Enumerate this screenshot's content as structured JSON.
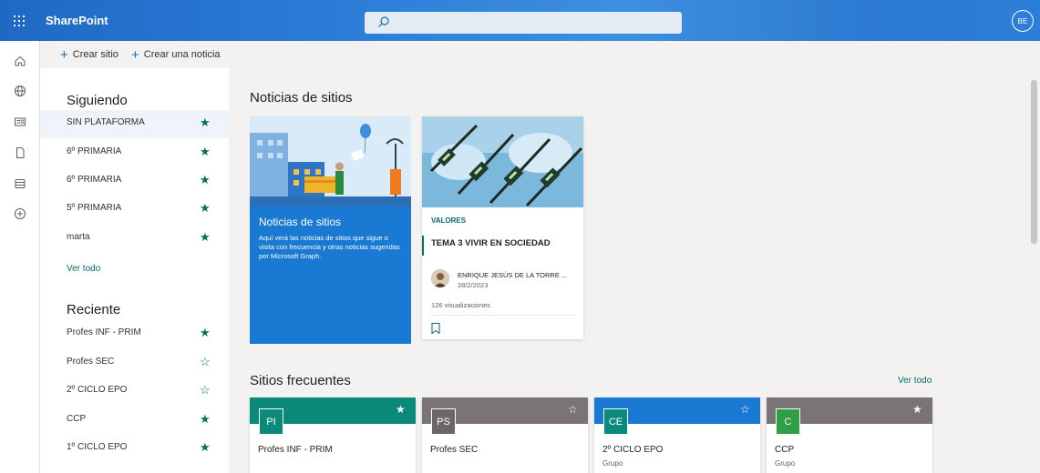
{
  "app": {
    "title": "SharePoint",
    "user_initials": "BE"
  },
  "colors": {
    "accent": "#0b6a62",
    "suite_bar": "#2a7bd6",
    "news_blue": "#1a7ad3"
  },
  "rail": {
    "icons": [
      "home-icon",
      "globe-icon",
      "news-icon",
      "file-icon",
      "list-icon",
      "add-circle-icon"
    ]
  },
  "commands": {
    "create_site": "Crear sitio",
    "create_news": "Crear una noticia"
  },
  "sidebar": {
    "following_title": "Siguiendo",
    "following": [
      {
        "name": "SIN PLATAFORMA",
        "starred": true
      },
      {
        "name": "6º PRIMARIA",
        "starred": true
      },
      {
        "name": "6º PRIMARIA",
        "starred": true
      },
      {
        "name": "5º PRIMARIA",
        "starred": true
      },
      {
        "name": "marta",
        "starred": true
      }
    ],
    "see_all": "Ver todo",
    "recent_title": "Reciente",
    "recent": [
      {
        "name": "Profes INF - PRIM",
        "starred": true
      },
      {
        "name": "Profes SEC",
        "starred": false
      },
      {
        "name": "2º CICLO EPO",
        "starred": false
      },
      {
        "name": "CCP",
        "starred": true
      },
      {
        "name": "1º CICLO EPO",
        "starred": true
      }
    ]
  },
  "news": {
    "title": "Noticias de sitios",
    "promo": {
      "title": "Noticias de sitios",
      "description": "Aquí verá las noticias de sitios que sigue o visita con frecuencia y otras noticias sugeridas por Microsoft Graph."
    },
    "article": {
      "category": "VALORES",
      "title": "TEMA 3 VIVIR EN SOCIEDAD",
      "author": "ENRIQUE JESÚS DE LA TORRE ...",
      "date": "28/2/2023",
      "views": "126 visualizaciones"
    }
  },
  "frequent": {
    "title": "Sitios frecuentes",
    "see_all": "Ver todo",
    "sites": [
      {
        "initials": "PI",
        "name": "Profes INF - PRIM",
        "type": "",
        "band_color": "#0b8a7a",
        "tile_color": "#0b8a7a",
        "starred": true
      },
      {
        "initials": "PS",
        "name": "Profes SEC",
        "type": "",
        "band_color": "#7a7574",
        "tile_color": "#6b6766",
        "starred": false
      },
      {
        "initials": "CE",
        "name": "2º CICLO EPO",
        "type": "Grupo",
        "band_color": "#1a7ad3",
        "tile_color": "#0b8a7a",
        "starred": false
      },
      {
        "initials": "C",
        "name": "CCP",
        "type": "Grupo",
        "band_color": "#7a7574",
        "tile_color": "#2f9e44",
        "starred": true
      }
    ]
  }
}
